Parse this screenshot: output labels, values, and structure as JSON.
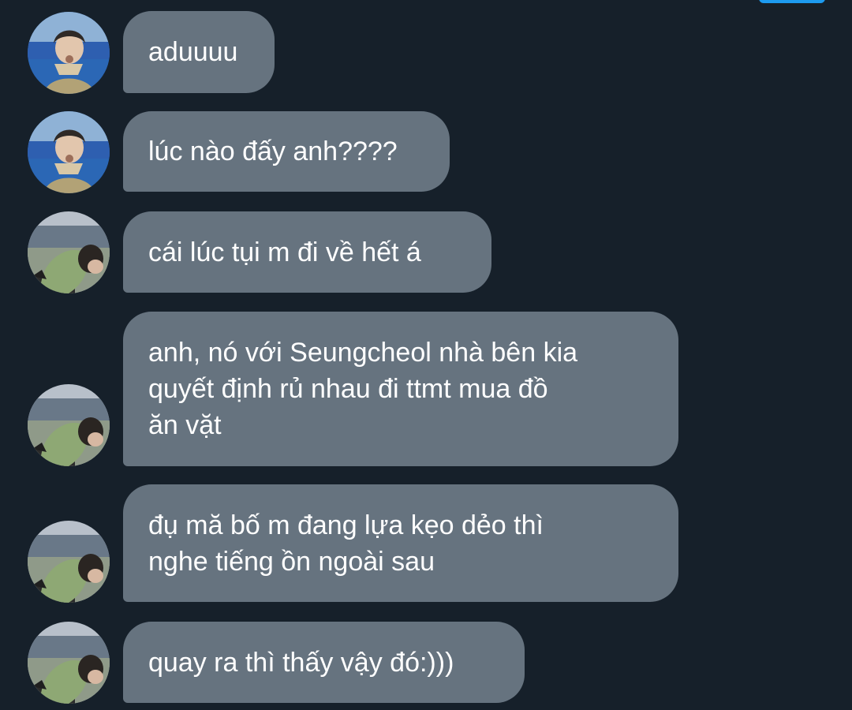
{
  "conversation": {
    "accent_color": "#1d9bf0",
    "bubble_color": "#66737f",
    "background_color": "#16202a",
    "messages": [
      {
        "sender": "avatar-a",
        "text": "aduuuu"
      },
      {
        "sender": "avatar-a",
        "text": "lúc nào đấy anh????"
      },
      {
        "sender": "avatar-b",
        "text": "cái lúc tụi m đi về hết á"
      },
      {
        "sender": "avatar-b",
        "text": "anh, nó với Seungcheol nhà bên kia\nquyết định rủ nhau đi ttmt mua đồ\năn vặt"
      },
      {
        "sender": "avatar-b",
        "text": "đụ mă bố m đang lựa kẹo dẻo thì\nnghe tiếng ồn ngoài sau"
      },
      {
        "sender": "avatar-b",
        "text": "quay ra thì thấy vậy đó:)))"
      }
    ]
  }
}
